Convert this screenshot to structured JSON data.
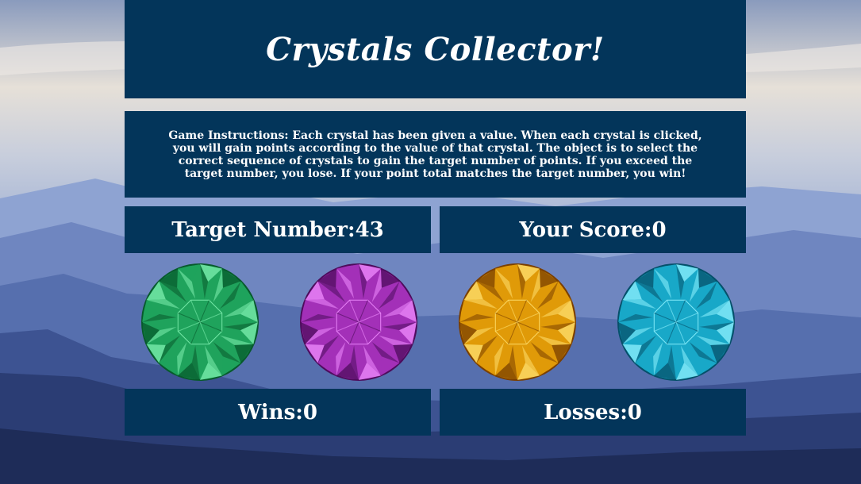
{
  "game": {
    "title": "Crystals Collector!",
    "instructions": "Game Instructions: Each crystal has been given a value. When each crystal is clicked, you will gain points according to the value of that crystal. The object is to select the correct sequence of crystals to gain the target number of points. If you exceed the target number, you lose. If your point total matches the target number, you win!",
    "target": {
      "label": "Target Number: ",
      "value": "43"
    },
    "score": {
      "label": "Your Score: ",
      "value": "0"
    },
    "wins": {
      "label": "Wins: ",
      "value": "0"
    },
    "losses": {
      "label": "Losses: ",
      "value": "0"
    }
  },
  "crystals": [
    {
      "name": "green-crystal",
      "color": "#1fa35c",
      "light": "#7ff0b0",
      "dark": "#075a2c"
    },
    {
      "name": "purple-crystal",
      "color": "#a330b8",
      "light": "#f08cff",
      "dark": "#4d0c5c"
    },
    {
      "name": "orange-crystal",
      "color": "#e09a08",
      "light": "#ffe070",
      "dark": "#7a3f00"
    },
    {
      "name": "blue-crystal",
      "color": "#18a8c8",
      "light": "#8ff2ff",
      "dark": "#05506a"
    }
  ],
  "colors": {
    "panel": "#03355a",
    "text": "#ffffff"
  }
}
